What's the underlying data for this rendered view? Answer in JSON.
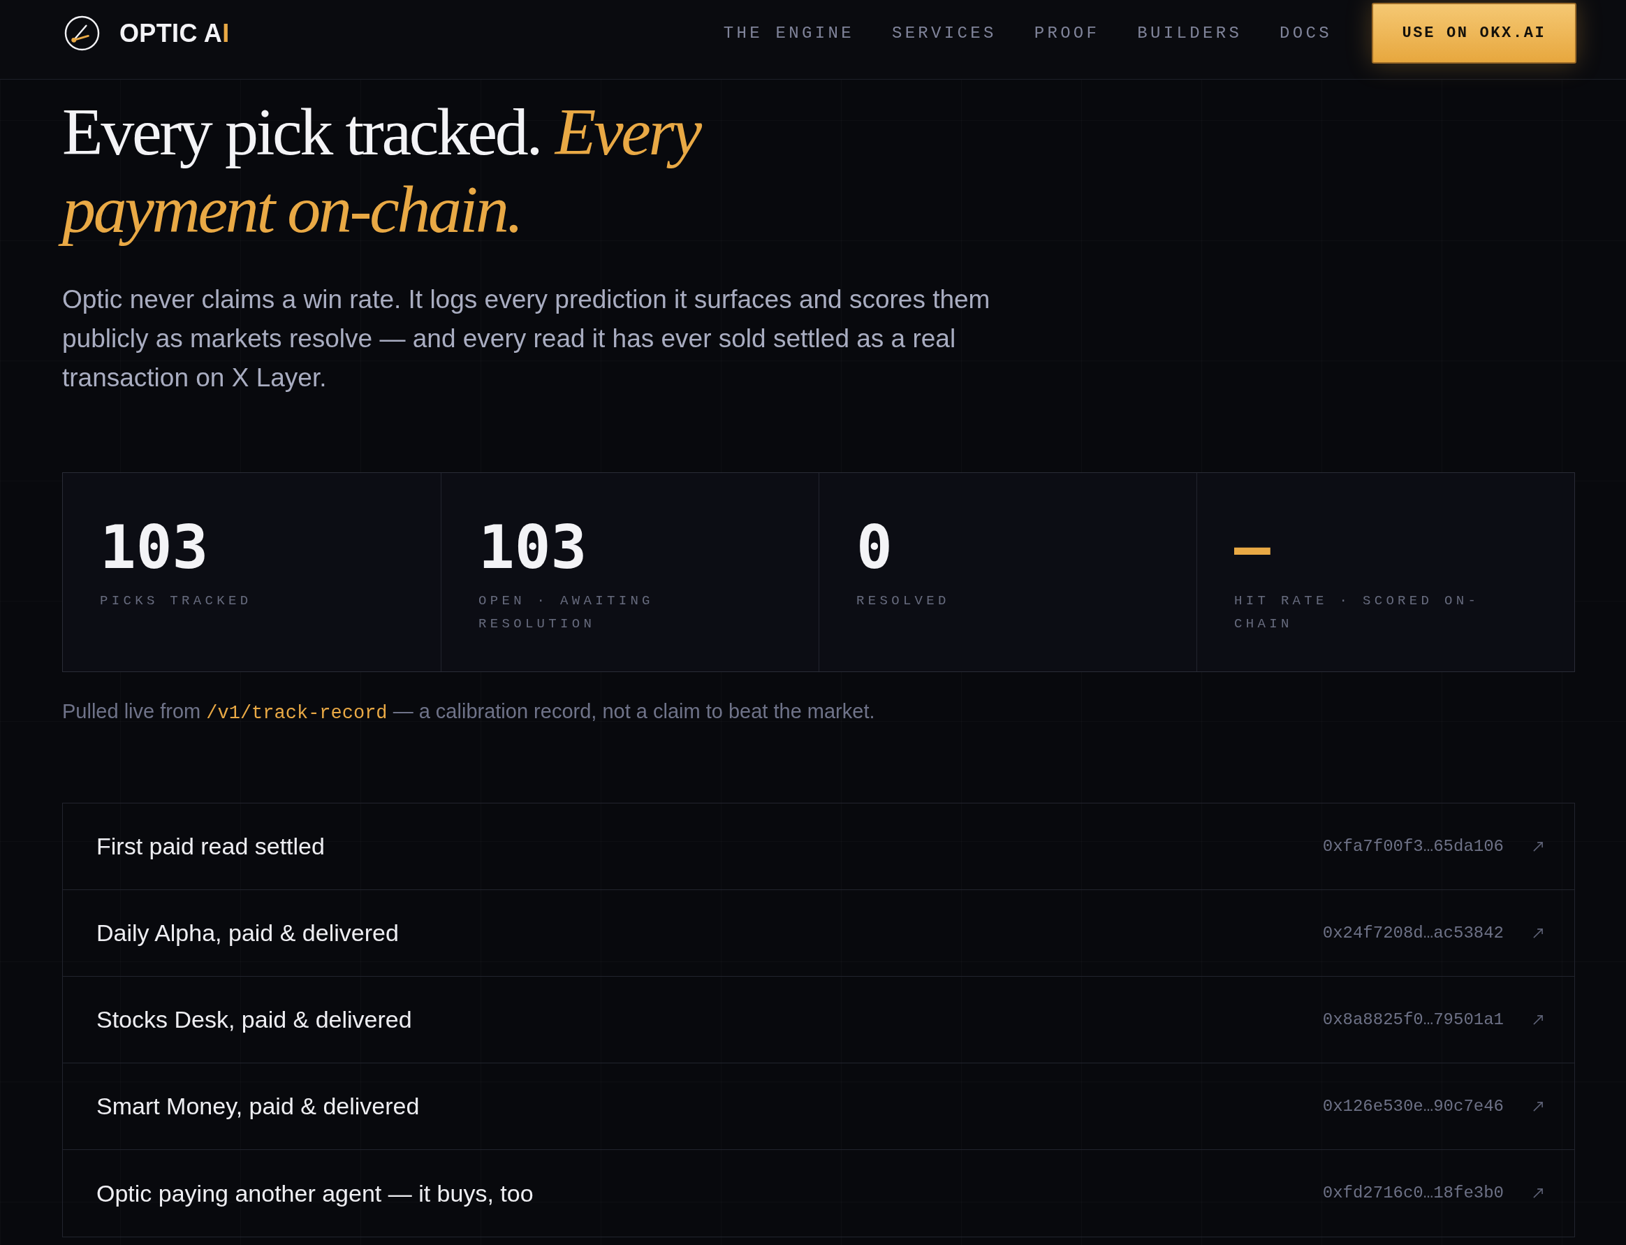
{
  "header": {
    "logo": {
      "text": "OPTIC A",
      "accent_text": "I"
    },
    "nav": [
      "THE ENGINE",
      "SERVICES",
      "PROOF",
      "BUILDERS",
      "DOCS"
    ],
    "cta": "USE ON OKX.AI"
  },
  "hero": {
    "headline": "Every pick tracked. *Every payment on-chain.*",
    "intro": "Optic never claims a win rate. It logs every prediction it surfaces and scores them publicly as markets resolve — and every read it has ever sold settled as a real transaction on X Layer."
  },
  "stats": [
    {
      "value": "103",
      "label": "PICKS TRACKED",
      "accent": false
    },
    {
      "value": "103",
      "label": "OPEN · AWAITING RESOLUTION",
      "accent": false
    },
    {
      "value": "0",
      "label": "RESOLVED",
      "accent": false
    },
    {
      "value": "—",
      "label": "HIT RATE · SCORED ON-CHAIN",
      "accent": true
    }
  ],
  "source_note": {
    "before": "Pulled live from",
    "code": "/v1/track-record",
    "after": "— a calibration record, not a claim to beat the market."
  },
  "proof_rows": [
    {
      "title": "First paid read settled",
      "tx": "0xfa7f00f3…65da106"
    },
    {
      "title": "Daily Alpha, paid & delivered",
      "tx": "0x24f7208d…ac53842"
    },
    {
      "title": "Stocks Desk, paid & delivered",
      "tx": "0x8a8825f0…79501a1"
    },
    {
      "title": "Smart Money, paid & delivered",
      "tx": "0x126e530e…90c7e46"
    },
    {
      "title": "Optic paying another agent — it buys, too",
      "tx": "0xfd2716c0…18fe3b0"
    }
  ]
}
